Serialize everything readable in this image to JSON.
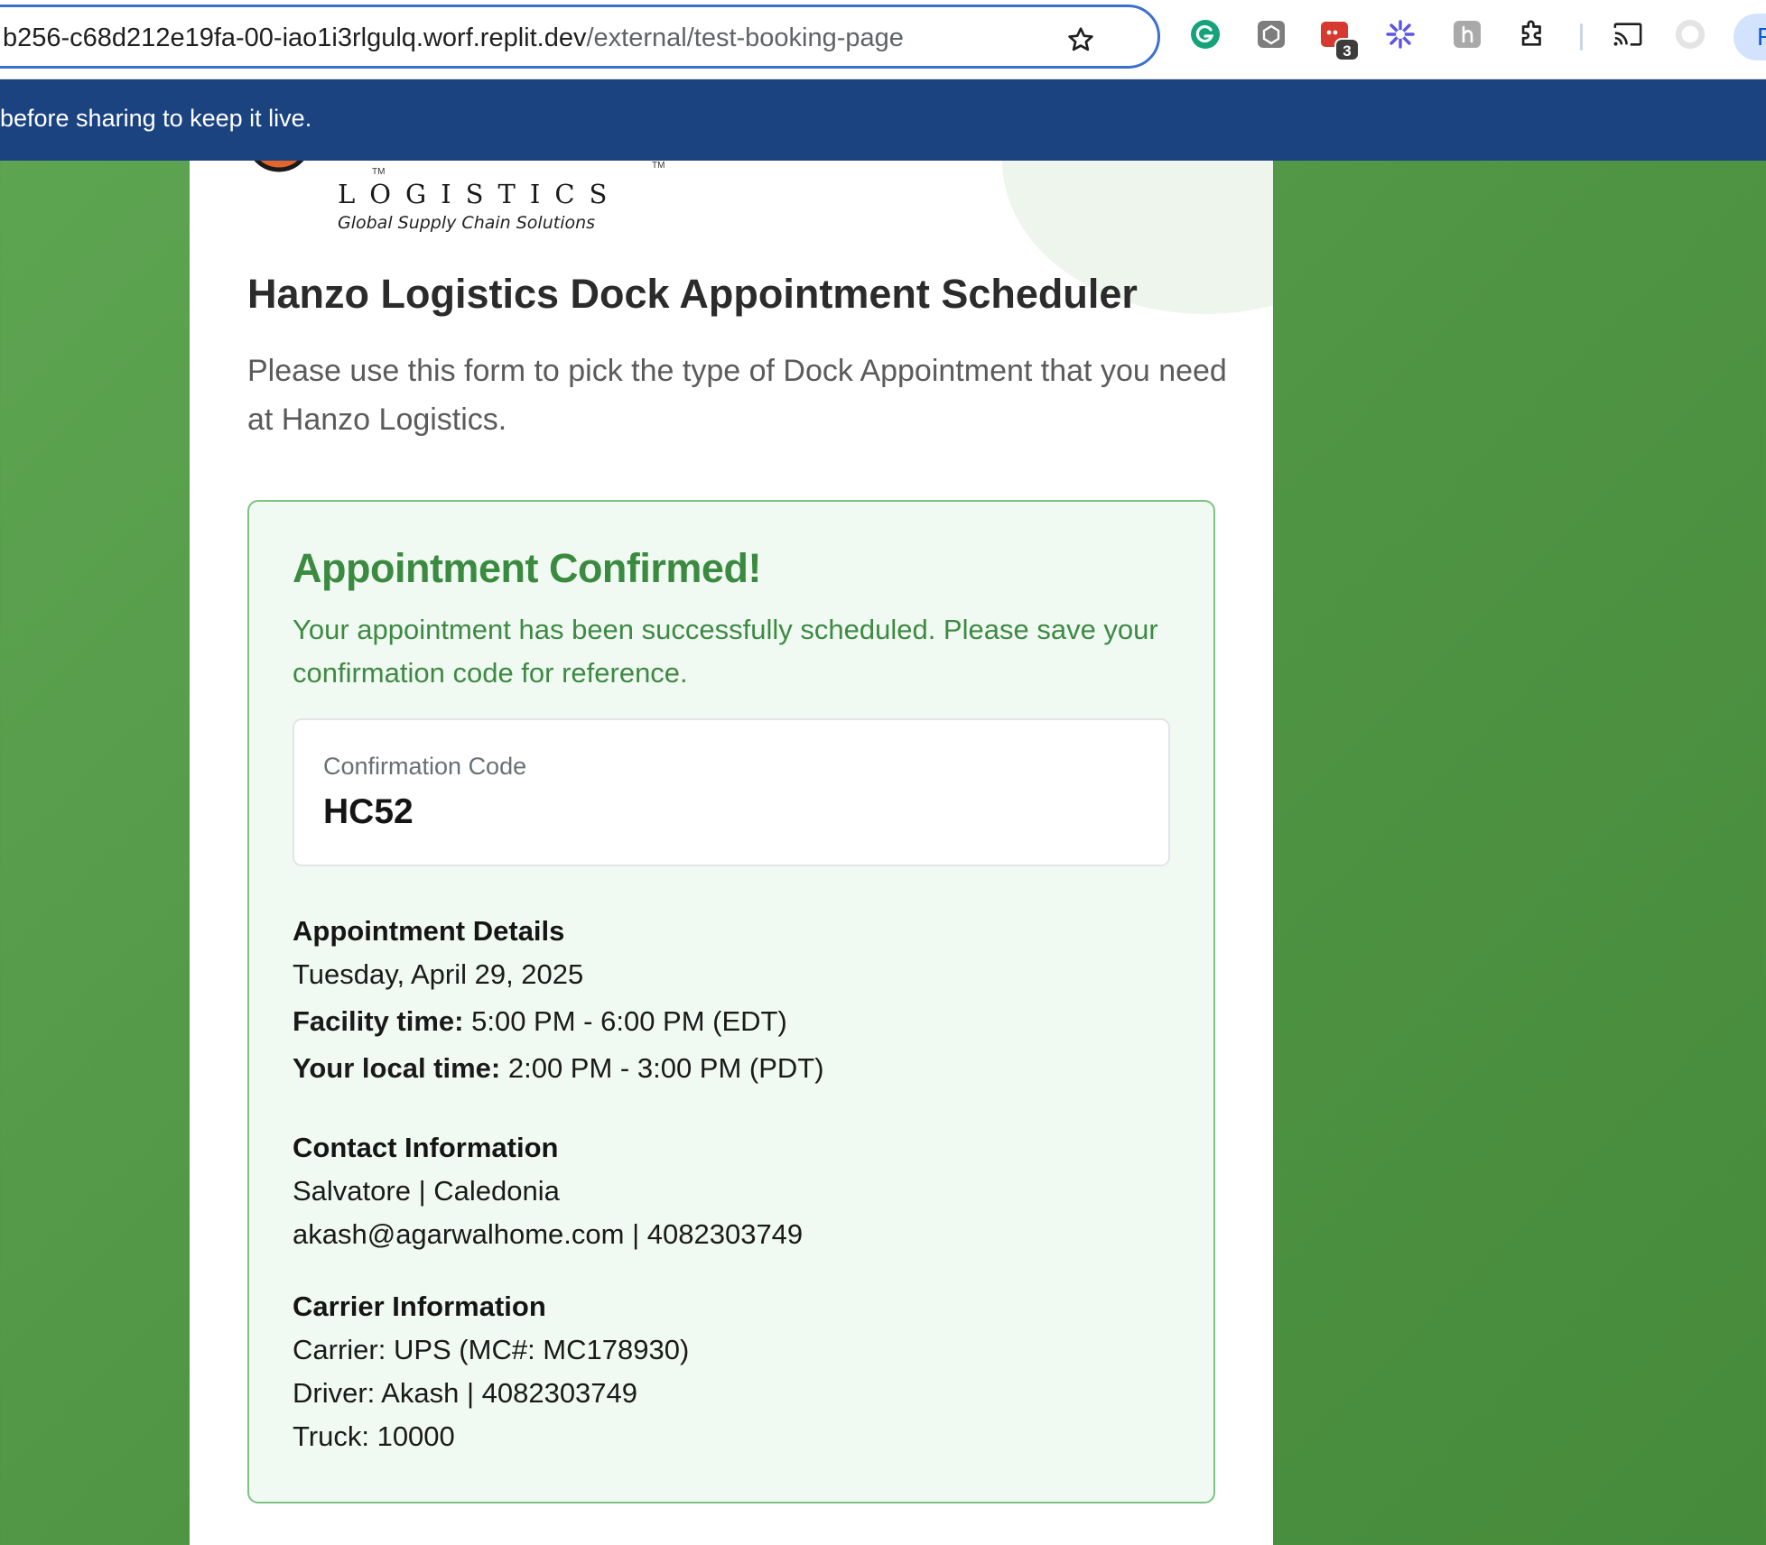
{
  "browser": {
    "url_host": "b256-c68d212e19fa-00-iao1i3rlgulq.worf.replit.dev",
    "url_path": "/external/test-booking-page",
    "extension_badge_count": "3",
    "profile_initial": "R"
  },
  "notice": {
    "text": "before sharing to keep it live."
  },
  "logo": {
    "word": "LOGISTICS",
    "tagline": "Global Supply Chain Solutions",
    "tm": "TM"
  },
  "page": {
    "title": "Hanzo Logistics Dock Appointment Scheduler",
    "subtitle": "Please use this form to pick the type of Dock Appointment that you need at Hanzo Logistics."
  },
  "confirmation": {
    "title": "Appointment Confirmed!",
    "message": "Your appointment has been successfully scheduled. Please save your confirmation code for reference.",
    "code_label": "Confirmation Code",
    "code_value": "HC52"
  },
  "appointment_details": {
    "heading": "Appointment Details",
    "date": "Tuesday, April 29, 2025",
    "facility_label": "Facility time:",
    "facility_value": " 5:00 PM - 6:00 PM (EDT)",
    "local_label": "Your local time:",
    "local_value": " 2:00 PM - 3:00 PM (PDT)"
  },
  "contact_information": {
    "heading": "Contact Information",
    "name_line": "Salvatore | Caledonia",
    "contact_line": "akash@agarwalhome.com | 4082303749"
  },
  "carrier_information": {
    "heading": "Carrier Information",
    "carrier_line": "Carrier: UPS (MC#: MC178930)",
    "driver_line": "Driver: Akash | 4082303749",
    "truck_line": "Truck: 10000"
  },
  "colors": {
    "page_bg": "#54994a",
    "banner": "#1b4380",
    "confirm_green": "#3a8a40",
    "panel_bg": "#f1faf2",
    "panel_border": "#7dc282",
    "omnibox_border": "#3d6fd0"
  },
  "icons": {
    "star": "star-icon",
    "grammarly": "grammarly-icon",
    "extension_gray": "extension-icon",
    "extension_red": "extension-red-icon",
    "asterisk": "asterisk-extension-icon",
    "puzzle": "extensions-puzzle-icon",
    "cast": "cast-icon",
    "profile": "profile-icon"
  }
}
